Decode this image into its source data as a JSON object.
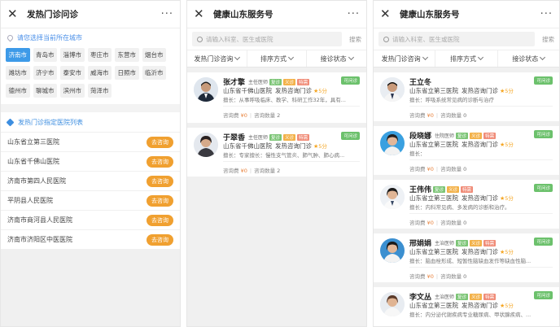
{
  "screens": [
    {
      "title": "发热门诊问诊",
      "close_icon": "close-icon",
      "more_label": "···",
      "location_prompt": "请您选择当前所在城市",
      "cities": [
        "济南市",
        "青岛市",
        "淄博市",
        "枣庄市",
        "东营市",
        "烟台市",
        "潍坊市",
        "济宁市",
        "泰安市",
        "威海市",
        "日照市",
        "临沂市",
        "德州市",
        "聊城市",
        "滨州市",
        "菏泽市"
      ],
      "selected_city": "济南市",
      "list_title": "发热门诊指定医院列表",
      "go_label": "去咨询",
      "hospitals": [
        "山东省立第三医院",
        "山东省千佛山医院",
        "济南市第四人民医院",
        "平阴县人民医院",
        "济南市商河县人民医院",
        "济南市济阳区中医医院"
      ]
    },
    {
      "title": "健康山东服务号",
      "more_label": "···",
      "search_placeholder": "请输入科室、医生或医院",
      "search_button": "搜索",
      "filters": [
        "发热门诊咨询",
        "排序方式",
        "接诊状态"
      ],
      "fee_label": "咨询费",
      "count_label": "咨询数量",
      "doctors": [
        {
          "name": "张才擎",
          "title": "主任医师",
          "tags": [
            "复诊",
            "义诊",
            "特需"
          ],
          "status": "可问诊",
          "hospital": "山东省千佛山医院",
          "dept": "发热咨询门诊",
          "score": "5分",
          "specialty": "擅长：从事呼吸临床、教学、科研工作32年，具有...",
          "fee": "¥0",
          "count": "2"
        },
        {
          "name": "于翠香",
          "title": "主任医师",
          "tags": [
            "复诊",
            "义诊",
            "特需"
          ],
          "status": "可问诊",
          "hospital": "山东省千佛山医院",
          "dept": "发热咨询门诊",
          "score": "5分",
          "specialty": "擅长：专家擅长：慢性支气管炎、肺气肿、肺心病...",
          "fee": "¥0",
          "count": "2"
        }
      ]
    },
    {
      "title": "健康山东服务号",
      "more_label": "···",
      "search_placeholder": "请输入科室、医生或医院",
      "search_button": "搜索",
      "filters": [
        "发热门诊咨询",
        "排序方式",
        "接诊状态"
      ],
      "fee_label": "咨询费",
      "count_label": "咨询数量",
      "doctors": [
        {
          "name": "王立冬",
          "title": "",
          "tags": [],
          "status": "可问诊",
          "hospital": "山东省立第三医院",
          "dept": "发热咨询门诊",
          "score": "5分",
          "specialty": "擅长：呼吸系统常见病的诊断与治疗",
          "fee": "¥0",
          "count": "0"
        },
        {
          "name": "段晓娜",
          "title": "住院医师",
          "tags": [
            "复诊",
            "义诊",
            "特需"
          ],
          "status": "可问诊",
          "hospital": "山东省立第三医院",
          "dept": "发热咨询门诊",
          "score": "5分",
          "specialty": "擅长：",
          "fee": "¥0",
          "count": "0"
        },
        {
          "name": "王伟伟",
          "title": "",
          "tags": [
            "复诊",
            "义诊",
            "特需"
          ],
          "status": "可问诊",
          "hospital": "山东省立第三医院",
          "dept": "发热咨询门诊",
          "score": "5分",
          "specialty": "擅长：内科常见病、多发病的诊断和治疗。",
          "fee": "¥0",
          "count": "0"
        },
        {
          "name": "邢娟娟",
          "title": "主治医师",
          "tags": [
            "复诊",
            "义诊",
            "特需"
          ],
          "status": "可问诊",
          "hospital": "山东省立第三医院",
          "dept": "发热咨询门诊",
          "score": "5分",
          "specialty": "擅长：脑血栓形成、短暂性脑缺血发作等缺血性脑...",
          "fee": "¥0",
          "count": "0"
        },
        {
          "name": "李文丛",
          "title": "主治医师",
          "tags": [
            "复诊",
            "义诊",
            "特需"
          ],
          "status": "可问诊",
          "hospital": "山东省立第三医院",
          "dept": "发热咨询门诊",
          "score": "5分",
          "specialty": "擅长：内分泌代谢疾病专业糖尿病、甲状腺疾病、...",
          "fee": "",
          "count": ""
        }
      ]
    }
  ],
  "colors": {
    "accent": "#3d9ae8",
    "orange": "#f0a030",
    "online": "#6cc16c"
  }
}
